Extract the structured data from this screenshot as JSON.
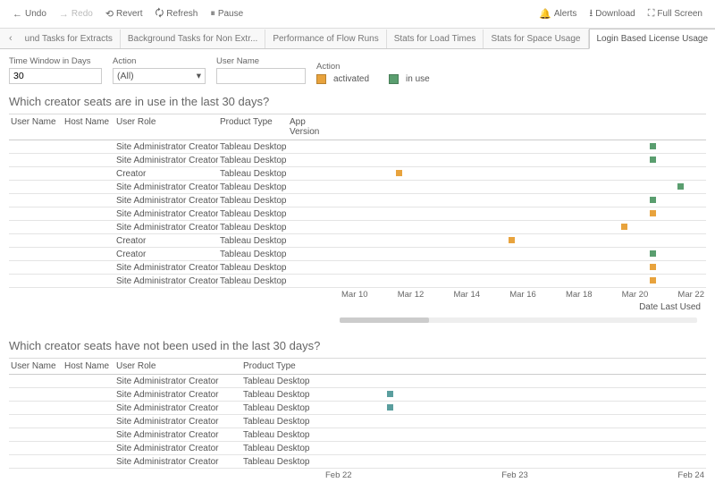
{
  "toolbar": {
    "undo": "Undo",
    "redo": "Redo",
    "revert": "Revert",
    "refresh": "Refresh",
    "pause": "Pause",
    "alerts": "Alerts",
    "download": "Download",
    "fullscreen": "Full Screen"
  },
  "tabs": {
    "items": [
      "und Tasks for Extracts",
      "Background Tasks for Non Extr...",
      "Performance of Flow Runs",
      "Stats for Load Times",
      "Stats for Space Usage",
      "Login Based License Usage"
    ],
    "activeIndex": 5
  },
  "filters": {
    "timeLabel": "Time Window in Days",
    "timeValue": "30",
    "actionLabel1": "Action",
    "actionValue1": "(All)",
    "userLabel": "User Name",
    "userValue": "",
    "legendLabel": "Action",
    "legendActivated": "activated",
    "legendInUse": "in use"
  },
  "section1": {
    "title": "Which creator seats are in use in the last 30 days?",
    "headers": {
      "h1": "User Name",
      "h2": "Host Name",
      "h3": "User Role",
      "h4": "Product Type",
      "h5": "App Version"
    }
  },
  "section2": {
    "title": "Which creator seats have not been used in the last 30 days?",
    "headers": {
      "h1": "User Name",
      "h2": "Host Name",
      "h3": "User Role",
      "h4": "Product Type"
    }
  },
  "axis1": {
    "label": "Date Last Used"
  },
  "chart_data": [
    {
      "type": "scatter",
      "title": "Which creator seats are in use in the last 30 days?",
      "xlabel": "Date Last Used",
      "x_ticks": [
        "Mar 10",
        "Mar 12",
        "Mar 14",
        "Mar 16",
        "Mar 18",
        "Mar 20",
        "Mar 22"
      ],
      "x_range": [
        "Mar 9",
        "Mar 22"
      ],
      "series_legend": [
        "activated",
        "in use"
      ],
      "rows": [
        {
          "user_role": "Site Administrator Creator",
          "product_type": "Tableau Desktop",
          "date": "Mar 20",
          "action": "in use"
        },
        {
          "user_role": "Site Administrator Creator",
          "product_type": "Tableau Desktop",
          "date": "Mar 20",
          "action": "in use"
        },
        {
          "user_role": "Creator",
          "product_type": "Tableau Desktop",
          "date": "Mar 11",
          "action": "activated"
        },
        {
          "user_role": "Site Administrator Creator",
          "product_type": "Tableau Desktop",
          "date": "Mar 21",
          "action": "in use"
        },
        {
          "user_role": "Site Administrator Creator",
          "product_type": "Tableau Desktop",
          "date": "Mar 20",
          "action": "in use"
        },
        {
          "user_role": "Site Administrator Creator",
          "product_type": "Tableau Desktop",
          "date": "Mar 20",
          "action": "activated"
        },
        {
          "user_role": "Site Administrator Creator",
          "product_type": "Tableau Desktop",
          "date": "Mar 19",
          "action": "activated"
        },
        {
          "user_role": "Creator",
          "product_type": "Tableau Desktop",
          "date": "Mar 15",
          "action": "activated"
        },
        {
          "user_role": "Creator",
          "product_type": "Tableau Desktop",
          "date": "Mar 20",
          "action": "in use"
        },
        {
          "user_role": "Site Administrator Creator",
          "product_type": "Tableau Desktop",
          "date": "Mar 20",
          "action": "activated"
        },
        {
          "user_role": "Site Administrator Creator",
          "product_type": "Tableau Desktop",
          "date": "Mar 20",
          "action": "activated"
        }
      ]
    },
    {
      "type": "scatter",
      "title": "Which creator seats have not been used in the last 30 days?",
      "x_ticks": [
        "Feb 22",
        "Feb 23",
        "Feb 24"
      ],
      "x_range": [
        "Feb 21.5",
        "Feb 24.5"
      ],
      "rows": [
        {
          "user_role": "Site Administrator Creator",
          "product_type": "Tableau Desktop",
          "date": null
        },
        {
          "user_role": "Site Administrator Creator",
          "product_type": "Tableau Desktop",
          "date": "Feb 22"
        },
        {
          "user_role": "Site Administrator Creator",
          "product_type": "Tableau Desktop",
          "date": "Feb 22"
        },
        {
          "user_role": "Site Administrator Creator",
          "product_type": "Tableau Desktop",
          "date": null
        },
        {
          "user_role": "Site Administrator Creator",
          "product_type": "Tableau Desktop",
          "date": null
        },
        {
          "user_role": "Site Administrator Creator",
          "product_type": "Tableau Desktop",
          "date": null
        },
        {
          "user_role": "Site Administrator Creator",
          "product_type": "Tableau Desktop",
          "date": null
        }
      ]
    }
  ]
}
